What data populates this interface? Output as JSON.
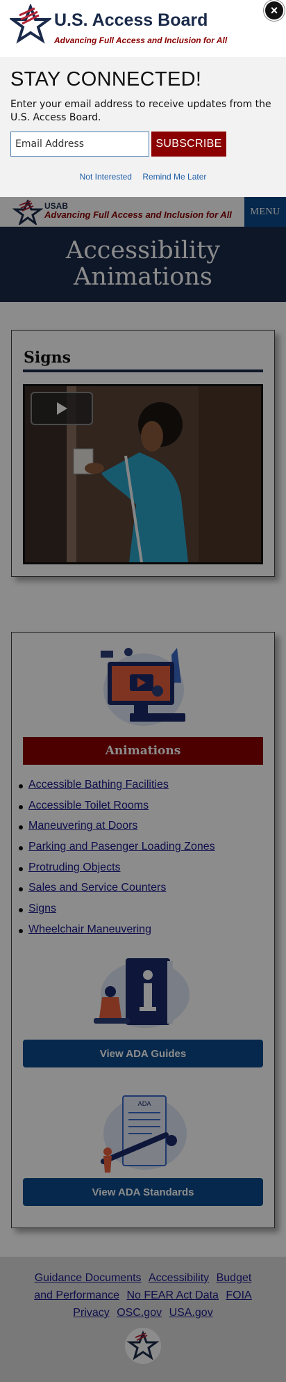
{
  "popup": {
    "brand": "U.S. Access Board",
    "tagline": "Advancing Full Access and Inclusion for All",
    "close_label": "×",
    "heading": "STAY CONNECTED!",
    "message": "Enter your email address to receive updates from the U.S. Access Board.",
    "email_placeholder": "Email Address",
    "subscribe_label": "SUBSCRIBE",
    "not_interested": "Not Interested",
    "remind_later": "Remind Me Later"
  },
  "header": {
    "short_brand": "USAB",
    "tagline": "Advancing Full Access and Inclusion for All",
    "menu_label": "MENU"
  },
  "hero": {
    "title_line1": "Accessibility",
    "title_line2": "Animations"
  },
  "video_card": {
    "heading": "Signs"
  },
  "links_card": {
    "bar_title": "Animations",
    "items": [
      "Accessible Bathing Facilities",
      "Accessible Toilet Rooms",
      "Maneuvering at Doors",
      "Parking and Pasenger Loading Zones",
      "Protruding Objects",
      "Sales and Service Counters",
      "Signs",
      "Wheelchair Maneuvering"
    ],
    "guides_button": "View ADA Guides",
    "standards_button": "View ADA Standards",
    "scroll_label": "ADA"
  },
  "footer": {
    "line1": [
      "Guidance Documents",
      "Accessibility",
      "Budget"
    ],
    "line2": [
      "and Performance",
      "No FEAR Act Data",
      "FOIA"
    ],
    "line3": [
      "Privacy",
      "OSC.gov",
      "USA.gov"
    ]
  },
  "colors": {
    "navy": "#1a2a4a",
    "maroon": "#8b0000",
    "button_blue": "#0b4a8b",
    "overlay": "rgba(0,0,0,0.45)"
  }
}
